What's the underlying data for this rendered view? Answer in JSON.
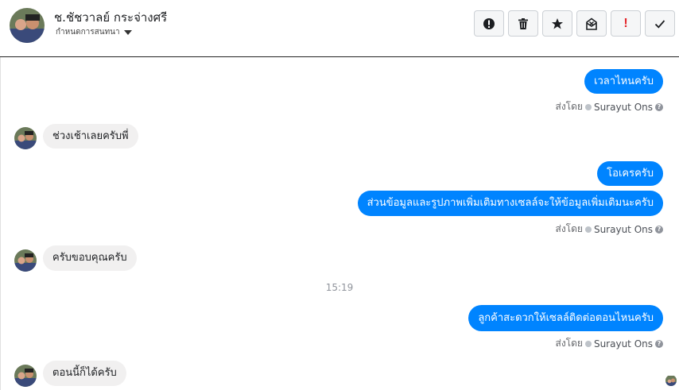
{
  "header": {
    "contact_name": "ช.ชัชวาลย์ กระจ่างศรี",
    "subtitle": "กำหนดการสนทนา",
    "toolbar": [
      {
        "icon": "exclamation-circle-icon"
      },
      {
        "icon": "trash-icon"
      },
      {
        "icon": "star-icon"
      },
      {
        "icon": "mail-archive-icon"
      },
      {
        "icon": "exclamation-mark-icon",
        "text": "!"
      },
      {
        "icon": "checkmark-icon"
      }
    ]
  },
  "messages": [
    {
      "side": "out",
      "text": "เวลาไหนครับ"
    },
    {
      "side": "meta",
      "prefix": "ส่งโดย",
      "name": "Surayut Ons",
      "help": "?"
    },
    {
      "side": "in",
      "text": "ช่วงเช้าเลยครับพี่"
    },
    {
      "side": "out",
      "text": "โอเครครับ"
    },
    {
      "side": "out",
      "text": "ส่วนข้อมูลและรูปภาพเพิ่มเติมทางเซลล์จะให้ข้อมูลเพิ่มเติมนะครับ"
    },
    {
      "side": "meta",
      "prefix": "ส่งโดย",
      "name": "Surayut Ons",
      "help": "?"
    },
    {
      "side": "in",
      "text": "ครับขอบคุณครับ"
    },
    {
      "side": "time",
      "text": "15:19"
    },
    {
      "side": "out",
      "text": "ลูกค้าสะดวกให้เซลล์ติดต่อตอนไหนครับ"
    },
    {
      "side": "meta",
      "prefix": "ส่งโดย",
      "name": "Surayut Ons",
      "help": "?"
    },
    {
      "side": "in",
      "text": "ตอนนี้ก็ได้ครับ"
    }
  ],
  "colors": {
    "outgoing": "#0084ff",
    "incoming": "#f1f0f0",
    "accent_red": "#e4262b"
  }
}
